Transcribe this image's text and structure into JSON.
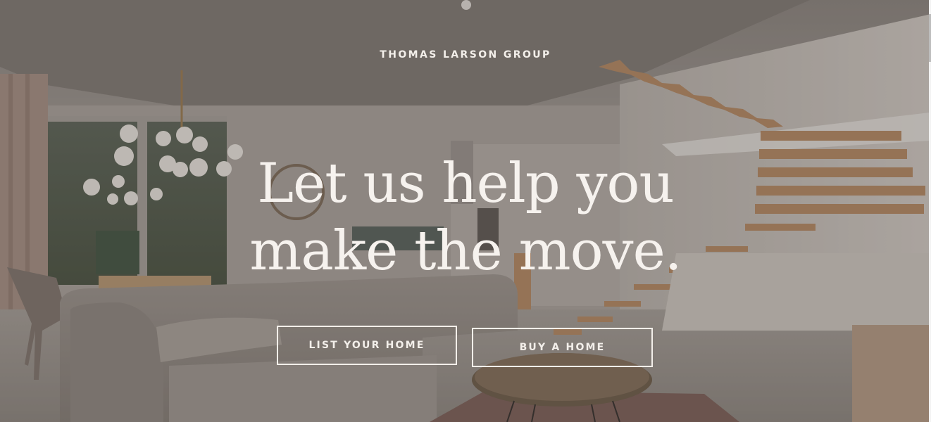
{
  "brand": {
    "name": "THOMAS LARSON GROUP"
  },
  "hero": {
    "headline_line1": "Let us help you",
    "headline_line2": "make the move.",
    "background_scene": "modern living room with staircase"
  },
  "actions": {
    "list_label": "LIST YOUR HOME",
    "buy_label": "BUY A HOME"
  },
  "colors": {
    "text": "#f3efea",
    "overlay": "#463e3a"
  }
}
